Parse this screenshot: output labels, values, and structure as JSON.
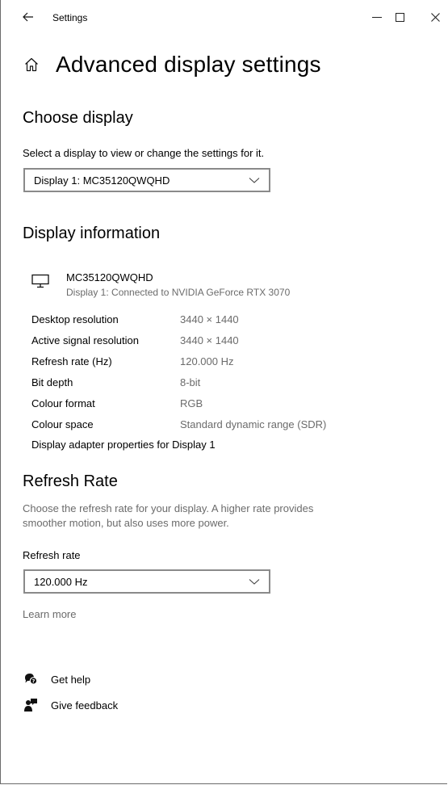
{
  "window": {
    "title": "Settings",
    "back_icon": "back-arrow-icon",
    "minimize_icon": "minimize-icon",
    "maximize_icon": "maximize-icon",
    "close_icon": "close-icon"
  },
  "page": {
    "title": "Advanced display settings",
    "home_icon": "home-icon"
  },
  "choose_display": {
    "heading": "Choose display",
    "description": "Select a display to view or change the settings for it.",
    "selected": "Display 1: MC35120QWQHD"
  },
  "display_information": {
    "heading": "Display information",
    "monitor_name": "MC35120QWQHD",
    "monitor_connection": "Display 1: Connected to NVIDIA GeForce RTX 3070",
    "rows": [
      {
        "label": "Desktop resolution",
        "value": "3440 × 1440"
      },
      {
        "label": "Active signal resolution",
        "value": "3440 × 1440"
      },
      {
        "label": "Refresh rate (Hz)",
        "value": "120.000 Hz"
      },
      {
        "label": "Bit depth",
        "value": "8-bit"
      },
      {
        "label": "Colour format",
        "value": "RGB"
      },
      {
        "label": "Colour space",
        "value": "Standard dynamic range (SDR)"
      }
    ],
    "adapter_link": "Display adapter properties for Display 1"
  },
  "refresh_rate": {
    "heading": "Refresh Rate",
    "description_line1": "Choose the refresh rate for your display. A higher rate provides",
    "description_line2": "smoother motion, but also uses more power.",
    "label": "Refresh rate",
    "selected": "120.000 Hz",
    "learn_more": "Learn more"
  },
  "help": {
    "get_help": "Get help",
    "give_feedback": "Give feedback"
  },
  "colors": {
    "text": "#000000",
    "muted": "#6b6b6b",
    "border": "#8a8a8a"
  }
}
